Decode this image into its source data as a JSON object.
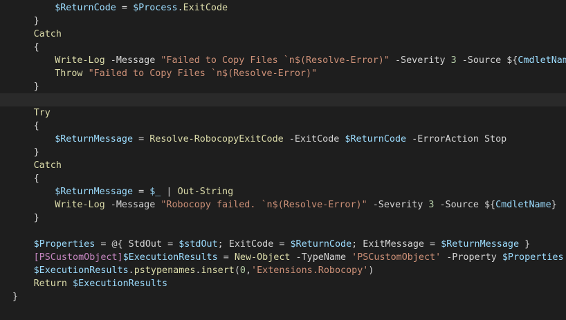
{
  "colors": {
    "background": "#1e1e1e",
    "current_line": "#2a2a2a",
    "variable": "#9cdcfe",
    "function": "#dcdcaa",
    "keyword": "#c586c0",
    "string": "#ce9178",
    "number": "#b5cea8",
    "type": "#4ec9b0",
    "text": "#d4d4d4"
  },
  "editor": {
    "lines": [
      {
        "indent": 8,
        "tokens": [
          {
            "t": "var",
            "v": "$ReturnCode"
          },
          {
            "t": "text",
            "v": " = "
          },
          {
            "t": "var",
            "v": "$Process"
          },
          {
            "t": "text",
            "v": "."
          },
          {
            "t": "fn",
            "v": "ExitCode"
          }
        ]
      },
      {
        "indent": 4,
        "tokens": [
          {
            "t": "text",
            "v": "}"
          }
        ]
      },
      {
        "indent": 4,
        "tokens": [
          {
            "t": "fn",
            "v": "Catch"
          }
        ]
      },
      {
        "indent": 4,
        "tokens": [
          {
            "t": "text",
            "v": "{"
          }
        ]
      },
      {
        "indent": 8,
        "tokens": [
          {
            "t": "fn",
            "v": "Write-Log"
          },
          {
            "t": "text",
            "v": " -Message "
          },
          {
            "t": "str",
            "v": "\"Failed to Copy Files `n$(Resolve-Error)\""
          },
          {
            "t": "text",
            "v": " -Severity "
          },
          {
            "t": "num",
            "v": "3"
          },
          {
            "t": "text",
            "v": " -Source "
          },
          {
            "t": "text",
            "v": "${"
          },
          {
            "t": "var",
            "v": "CmdletName"
          },
          {
            "t": "text",
            "v": "}"
          }
        ]
      },
      {
        "indent": 8,
        "tokens": [
          {
            "t": "fn",
            "v": "Throw"
          },
          {
            "t": "text",
            "v": " "
          },
          {
            "t": "str",
            "v": "\"Failed to Copy Files `n$(Resolve-Error)\""
          }
        ]
      },
      {
        "indent": 4,
        "tokens": [
          {
            "t": "text",
            "v": "}"
          }
        ]
      },
      {
        "indent": 0,
        "current": true,
        "tokens": []
      },
      {
        "indent": 4,
        "tokens": [
          {
            "t": "fn",
            "v": "Try"
          }
        ]
      },
      {
        "indent": 4,
        "tokens": [
          {
            "t": "text",
            "v": "{"
          }
        ]
      },
      {
        "indent": 8,
        "tokens": [
          {
            "t": "var",
            "v": "$ReturnMessage"
          },
          {
            "t": "text",
            "v": " = "
          },
          {
            "t": "fn",
            "v": "Resolve-RobocopyExitCode"
          },
          {
            "t": "text",
            "v": " -ExitCode "
          },
          {
            "t": "var",
            "v": "$ReturnCode"
          },
          {
            "t": "text",
            "v": " -ErrorAction Stop"
          }
        ]
      },
      {
        "indent": 4,
        "tokens": [
          {
            "t": "text",
            "v": "}"
          }
        ]
      },
      {
        "indent": 4,
        "tokens": [
          {
            "t": "fn",
            "v": "Catch"
          }
        ]
      },
      {
        "indent": 4,
        "tokens": [
          {
            "t": "text",
            "v": "{"
          }
        ]
      },
      {
        "indent": 8,
        "tokens": [
          {
            "t": "var",
            "v": "$ReturnMessage"
          },
          {
            "t": "text",
            "v": " = "
          },
          {
            "t": "var",
            "v": "$_"
          },
          {
            "t": "text",
            "v": " | "
          },
          {
            "t": "fn",
            "v": "Out-String"
          }
        ]
      },
      {
        "indent": 8,
        "tokens": [
          {
            "t": "fn",
            "v": "Write-Log"
          },
          {
            "t": "text",
            "v": " -Message "
          },
          {
            "t": "str",
            "v": "\"Robocopy failed. `n$(Resolve-Error)\""
          },
          {
            "t": "text",
            "v": " -Severity "
          },
          {
            "t": "num",
            "v": "3"
          },
          {
            "t": "text",
            "v": " -Source "
          },
          {
            "t": "text",
            "v": "${"
          },
          {
            "t": "var",
            "v": "CmdletName"
          },
          {
            "t": "text",
            "v": "}"
          }
        ]
      },
      {
        "indent": 4,
        "tokens": [
          {
            "t": "text",
            "v": "}"
          }
        ]
      },
      {
        "indent": 0,
        "tokens": []
      },
      {
        "indent": 4,
        "tokens": [
          {
            "t": "var",
            "v": "$Properties"
          },
          {
            "t": "text",
            "v": " = @{ StdOut = "
          },
          {
            "t": "var",
            "v": "$stdOut"
          },
          {
            "t": "text",
            "v": "; ExitCode = "
          },
          {
            "t": "var",
            "v": "$ReturnCode"
          },
          {
            "t": "text",
            "v": "; ExitMessage = "
          },
          {
            "t": "var",
            "v": "$ReturnMessage"
          },
          {
            "t": "text",
            "v": " }"
          }
        ]
      },
      {
        "indent": 4,
        "tokens": [
          {
            "t": "kw",
            "v": "[PSCustomObject]"
          },
          {
            "t": "var",
            "v": "$ExecutionResults"
          },
          {
            "t": "text",
            "v": " = "
          },
          {
            "t": "fn",
            "v": "New-Object"
          },
          {
            "t": "text",
            "v": " -TypeName "
          },
          {
            "t": "str",
            "v": "'PSCustomObject'"
          },
          {
            "t": "text",
            "v": " -Property "
          },
          {
            "t": "var",
            "v": "$Properties"
          }
        ]
      },
      {
        "indent": 4,
        "tokens": [
          {
            "t": "var",
            "v": "$ExecutionResults"
          },
          {
            "t": "text",
            "v": "."
          },
          {
            "t": "fn",
            "v": "pstypenames"
          },
          {
            "t": "text",
            "v": "."
          },
          {
            "t": "fn",
            "v": "insert"
          },
          {
            "t": "text",
            "v": "("
          },
          {
            "t": "num",
            "v": "0"
          },
          {
            "t": "text",
            "v": ","
          },
          {
            "t": "str",
            "v": "'Extensions.Robocopy'"
          },
          {
            "t": "text",
            "v": ")"
          }
        ]
      },
      {
        "indent": 4,
        "tokens": [
          {
            "t": "fn",
            "v": "Return"
          },
          {
            "t": "text",
            "v": " "
          },
          {
            "t": "var",
            "v": "$ExecutionResults"
          }
        ]
      },
      {
        "indent": 0,
        "tokens": [
          {
            "t": "text",
            "v": "}"
          }
        ]
      }
    ]
  }
}
